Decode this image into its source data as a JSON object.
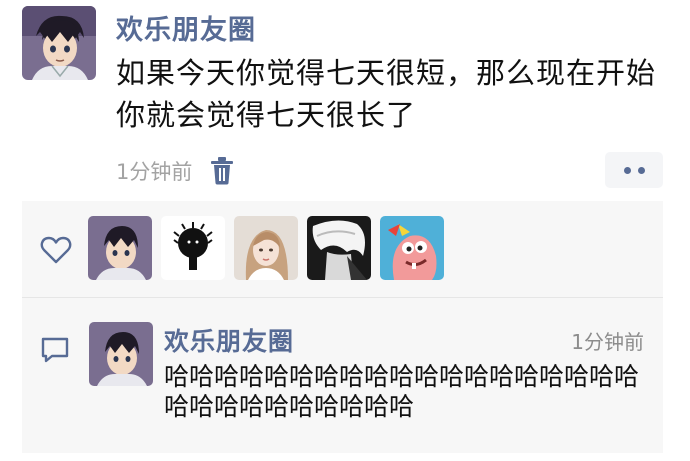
{
  "post": {
    "author": "欢乐朋友圈",
    "content": "如果今天你觉得七天很短，那么现在开始你就会觉得七天很长了",
    "time": "1分钟前",
    "delete_icon": "trash-icon",
    "more_icon": "more-dots-icon"
  },
  "likes": {
    "icon": "heart-outline-icon",
    "avatars": [
      "anime-boy",
      "black-silhouette",
      "young-woman",
      "white-hair",
      "cartoon-starfish"
    ]
  },
  "comments": [
    {
      "icon": "comment-bubble-icon",
      "author": "欢乐朋友圈",
      "time": "1分钟前",
      "text": "哈哈哈哈哈哈哈哈哈哈哈哈哈哈哈哈哈哈哈哈哈哈哈哈哈哈哈哈哈"
    }
  ],
  "colors": {
    "name_blue": "#576b95",
    "panel_bg": "#f7f7f7",
    "meta_gray": "#a3a3a3"
  }
}
